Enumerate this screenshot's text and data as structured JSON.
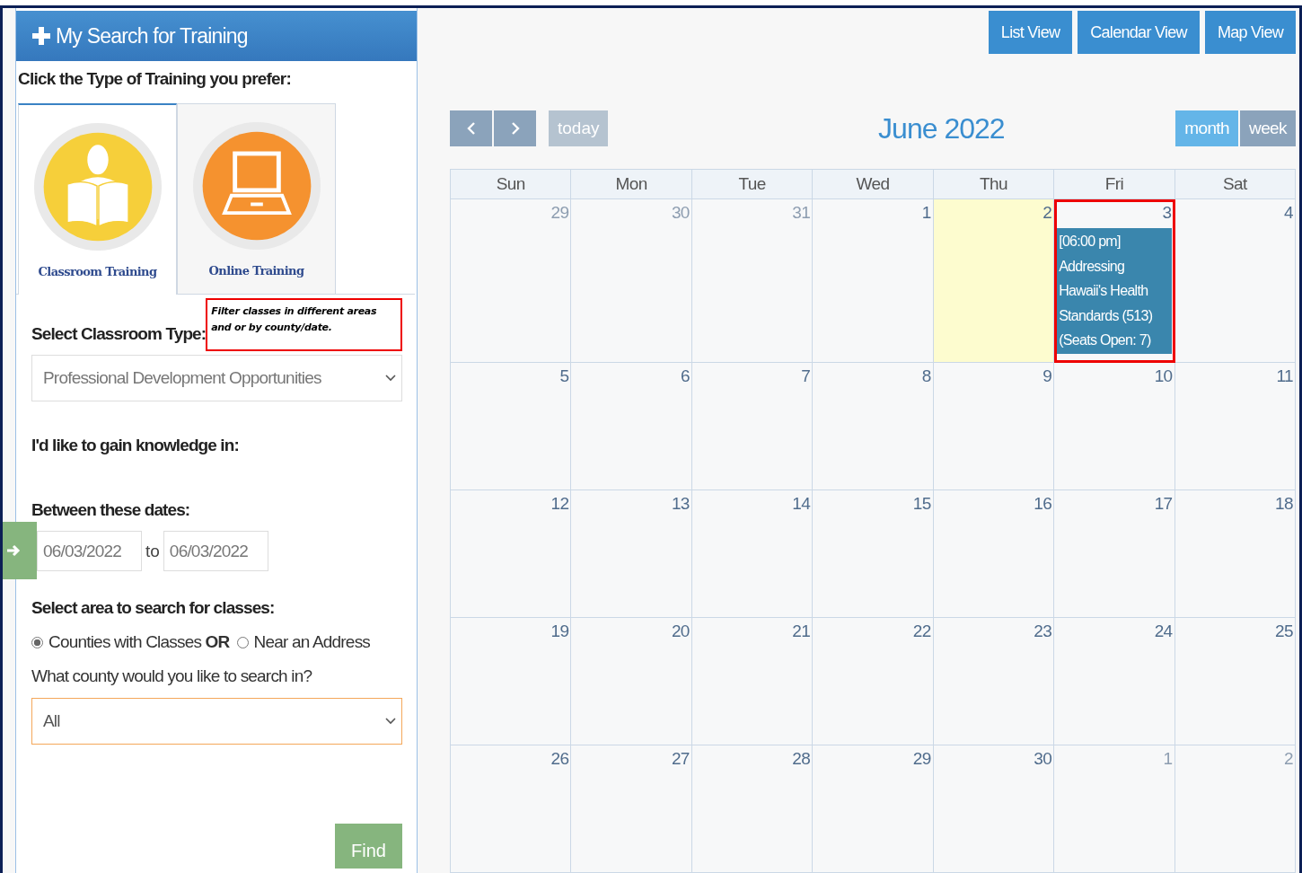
{
  "panel": {
    "title": "My Search for Training",
    "prompt": "Click the Type of Training you prefer:",
    "training_types": [
      {
        "label": "Classroom Training",
        "kind": "classroom",
        "selected": true
      },
      {
        "label": "Online Training",
        "kind": "online",
        "selected": false
      }
    ],
    "classroom_type_label": "Select Classroom Type:",
    "callout": "Filter classes in different areas and or by county/date.",
    "classroom_type_value": "Professional Development Opportunities",
    "knowledge_label": "I'd like to gain knowledge in:",
    "dates_label": "Between these dates:",
    "date_from": "06/03/2022",
    "date_sep": "to",
    "date_to": "06/03/2022",
    "area_label": "Select area to search for classes:",
    "area_options": [
      {
        "label": "Counties with Classes **OR**",
        "selected": true
      },
      {
        "label": "Near an Address",
        "selected": false
      }
    ],
    "county_label": "What county would you like to search in?",
    "county_value": "All",
    "find_button": "Find"
  },
  "view_buttons": [
    "List View",
    "Calendar View",
    "Map View"
  ],
  "calendar": {
    "title": "June 2022",
    "today_button": "today",
    "today_disabled": true,
    "modes": [
      {
        "label": "month",
        "selected": true
      },
      {
        "label": "week",
        "selected": false
      }
    ],
    "weekdays": [
      "Sun",
      "Mon",
      "Tue",
      "Wed",
      "Thu",
      "Fri",
      "Sat"
    ],
    "weeks": [
      [
        {
          "day": "29",
          "other_month": true,
          "today": false,
          "highlighted": false
        },
        {
          "day": "30",
          "other_month": true,
          "today": false,
          "highlighted": false
        },
        {
          "day": "31",
          "other_month": true,
          "today": false,
          "highlighted": false
        },
        {
          "day": "1",
          "other_month": false,
          "today": false,
          "highlighted": false
        },
        {
          "day": "2",
          "other_month": false,
          "today": true,
          "highlighted": false
        },
        {
          "day": "3",
          "other_month": false,
          "today": false,
          "highlighted": true,
          "events": [
            {
              "lines": [
                "[06:00 pm]",
                "Addressing",
                "Hawaii's Health",
                "Standards (513)",
                "(Seats Open: 7)"
              ]
            }
          ]
        },
        {
          "day": "4",
          "other_month": false,
          "today": false,
          "highlighted": false
        }
      ],
      [
        {
          "day": "5",
          "other_month": false,
          "today": false,
          "highlighted": false
        },
        {
          "day": "6",
          "other_month": false,
          "today": false,
          "highlighted": false
        },
        {
          "day": "7",
          "other_month": false,
          "today": false,
          "highlighted": false
        },
        {
          "day": "8",
          "other_month": false,
          "today": false,
          "highlighted": false
        },
        {
          "day": "9",
          "other_month": false,
          "today": false,
          "highlighted": false
        },
        {
          "day": "10",
          "other_month": false,
          "today": false,
          "highlighted": false
        },
        {
          "day": "11",
          "other_month": false,
          "today": false,
          "highlighted": false
        }
      ],
      [
        {
          "day": "12",
          "other_month": false,
          "today": false,
          "highlighted": false
        },
        {
          "day": "13",
          "other_month": false,
          "today": false,
          "highlighted": false
        },
        {
          "day": "14",
          "other_month": false,
          "today": false,
          "highlighted": false
        },
        {
          "day": "15",
          "other_month": false,
          "today": false,
          "highlighted": false
        },
        {
          "day": "16",
          "other_month": false,
          "today": false,
          "highlighted": false
        },
        {
          "day": "17",
          "other_month": false,
          "today": false,
          "highlighted": false
        },
        {
          "day": "18",
          "other_month": false,
          "today": false,
          "highlighted": false
        }
      ],
      [
        {
          "day": "19",
          "other_month": false,
          "today": false,
          "highlighted": false
        },
        {
          "day": "20",
          "other_month": false,
          "today": false,
          "highlighted": false
        },
        {
          "day": "21",
          "other_month": false,
          "today": false,
          "highlighted": false
        },
        {
          "day": "22",
          "other_month": false,
          "today": false,
          "highlighted": false
        },
        {
          "day": "23",
          "other_month": false,
          "today": false,
          "highlighted": false
        },
        {
          "day": "24",
          "other_month": false,
          "today": false,
          "highlighted": false
        },
        {
          "day": "25",
          "other_month": false,
          "today": false,
          "highlighted": false
        }
      ],
      [
        {
          "day": "26",
          "other_month": false,
          "today": false,
          "highlighted": false
        },
        {
          "day": "27",
          "other_month": false,
          "today": false,
          "highlighted": false
        },
        {
          "day": "28",
          "other_month": false,
          "today": false,
          "highlighted": false
        },
        {
          "day": "29",
          "other_month": false,
          "today": false,
          "highlighted": false
        },
        {
          "day": "30",
          "other_month": false,
          "today": false,
          "highlighted": false
        },
        {
          "day": "1",
          "other_month": true,
          "today": false,
          "highlighted": false
        },
        {
          "day": "2",
          "other_month": true,
          "today": false,
          "highlighted": false
        }
      ]
    ]
  }
}
